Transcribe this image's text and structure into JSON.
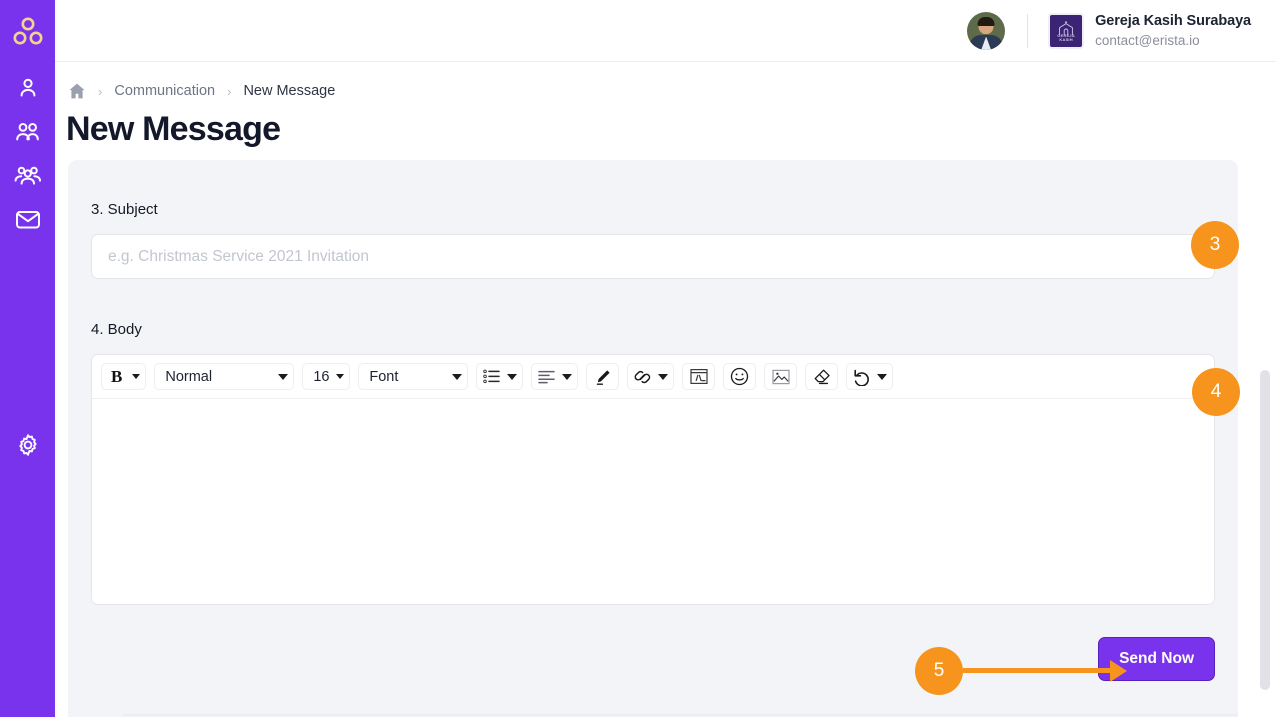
{
  "colors": {
    "sidebar": "#7a33ec",
    "accent_purple": "#7a33ec",
    "annotation_orange": "#f7941d",
    "card_bg": "#f3f4f7",
    "org_logo_bg": "#3b2473"
  },
  "sidebar": {
    "brand_icon": "triad-nodes-logo-icon",
    "items": [
      {
        "icon": "person-icon",
        "name": "sidebar-item-person"
      },
      {
        "icon": "two-people-icon",
        "name": "sidebar-item-people"
      },
      {
        "icon": "group-of-people-icon",
        "name": "sidebar-item-groups"
      },
      {
        "icon": "envelope-icon",
        "name": "sidebar-item-communication"
      }
    ],
    "settings": {
      "icon": "gear-icon",
      "name": "sidebar-item-settings"
    }
  },
  "header": {
    "avatar_alt": "user-avatar-photo",
    "org_logo_text": "GEREJA KASIH",
    "org_name": "Gereja Kasih Surabaya",
    "org_email": "contact@erista.io"
  },
  "breadcrumb": {
    "home_icon": "home-icon",
    "separator": "›",
    "items": [
      "Communication",
      "New Message"
    ]
  },
  "page": {
    "title": "New Message"
  },
  "form": {
    "subject": {
      "label": "3. Subject",
      "placeholder": "e.g. Christmas Service 2021 Invitation",
      "value": ""
    },
    "body": {
      "label": "4. Body",
      "content": ""
    }
  },
  "toolbar": {
    "bold": {
      "label": "B",
      "name": "bold-button"
    },
    "style": {
      "value": "Normal",
      "name": "text-style-select"
    },
    "size": {
      "value": "16",
      "name": "font-size-select"
    },
    "font": {
      "value": "Font",
      "name": "font-family-select"
    },
    "list": {
      "icon": "bullet-list-icon",
      "name": "list-button"
    },
    "align": {
      "icon": "align-left-icon",
      "name": "align-button"
    },
    "highlight": {
      "icon": "pen-icon",
      "name": "highlight-button"
    },
    "link": {
      "icon": "link-icon",
      "name": "link-button"
    },
    "embed": {
      "icon": "code-embed-icon",
      "name": "embed-button"
    },
    "emoji": {
      "icon": "smiley-icon",
      "name": "emoji-button"
    },
    "image": {
      "icon": "image-icon",
      "name": "image-button"
    },
    "clear": {
      "icon": "eraser-icon",
      "name": "clear-formatting-button"
    },
    "undo": {
      "icon": "undo-arrow-icon",
      "name": "undo-button"
    }
  },
  "actions": {
    "send_label": "Send Now"
  },
  "annotations": {
    "step3": "3",
    "step4": "4",
    "step5": "5"
  }
}
